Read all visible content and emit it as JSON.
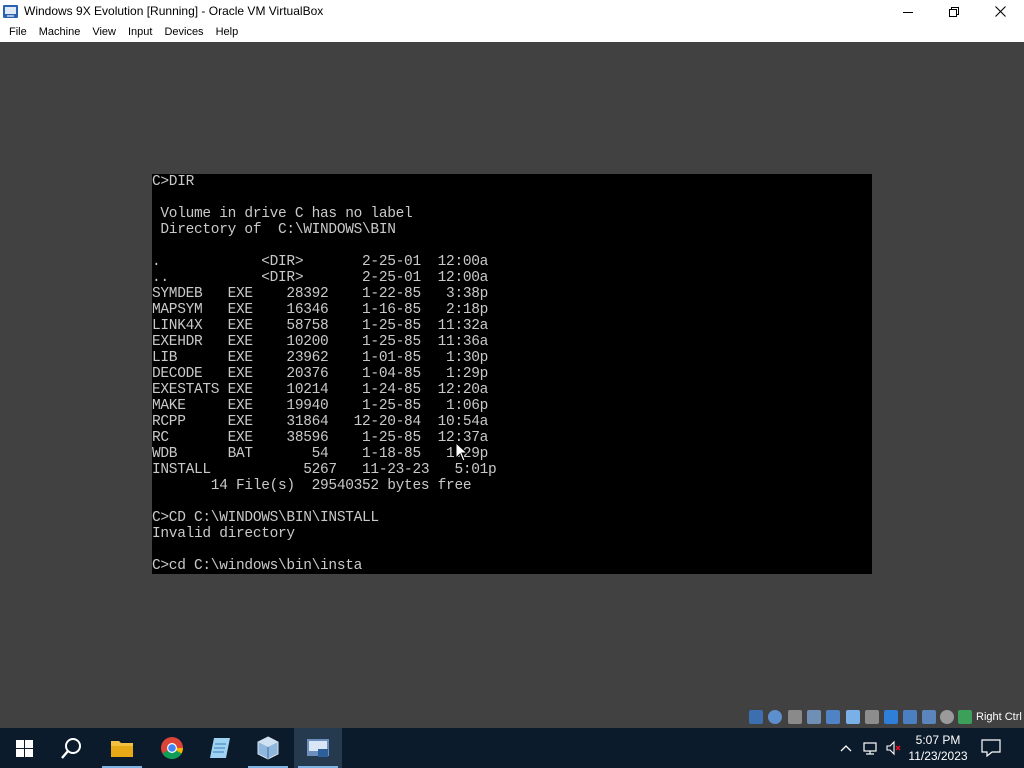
{
  "window": {
    "title": "Windows 9X Evolution [Running] - Oracle VM VirtualBox"
  },
  "menu": {
    "items": [
      "File",
      "Machine",
      "View",
      "Input",
      "Devices",
      "Help"
    ]
  },
  "console": {
    "lines": [
      "C>DIR",
      "",
      " Volume in drive C has no label",
      " Directory of  C:\\WINDOWS\\BIN",
      "",
      ".            <DIR>       2-25-01  12:00a",
      "..           <DIR>       2-25-01  12:00a",
      "SYMDEB   EXE    28392    1-22-85   3:38p",
      "MAPSYM   EXE    16346    1-16-85   2:18p",
      "LINK4X   EXE    58758    1-25-85  11:32a",
      "EXEHDR   EXE    10200    1-25-85  11:36a",
      "LIB      EXE    23962    1-01-85   1:30p",
      "DECODE   EXE    20376    1-04-85   1:29p",
      "EXESTATS EXE    10214    1-24-85  12:20a",
      "MAKE     EXE    19940    1-25-85   1:06p",
      "RCPP     EXE    31864   12-20-84  10:54a",
      "RC       EXE    38596    1-25-85  12:37a",
      "WDB      BAT       54    1-18-85   1:29p",
      "INSTALL           5267   11-23-23   5:01p",
      "       14 File(s)  29540352 bytes free",
      "",
      "C>CD C:\\WINDOWS\\BIN\\INSTALL",
      "Invalid directory",
      "",
      "C>cd C:\\windows\\bin\\insta"
    ]
  },
  "statusbar": {
    "host_key": "Right Ctrl",
    "icons": [
      "hard-disk-icon",
      "optical-drive-icon",
      "floppy-icon",
      "audio-icon",
      "network-icon",
      "usb-icon",
      "shared-folders-icon",
      "display-icon",
      "video-capture-icon",
      "monitor-icon",
      "screenshot-icon",
      "processor-icon",
      "mouse-integration-icon",
      "keyboard-capture-icon"
    ]
  },
  "taskbar": {
    "apps": [
      "start-icon",
      "search-icon",
      "file-explorer-icon",
      "chrome-icon",
      "notepad-icon",
      "virtualbox-icon",
      "vm-window-icon"
    ],
    "tray": [
      "chevron-up-icon",
      "network-icon",
      "speaker-muted-icon"
    ],
    "clock": {
      "time": "5:07 PM",
      "date": "11/23/2023"
    },
    "notification_icon": "notification-icon"
  },
  "colors": {
    "console_bg": "#000000",
    "console_fg": "#c9c9c9",
    "host_bg": "#414141",
    "taskbar_bg": "#0c1b2b"
  }
}
